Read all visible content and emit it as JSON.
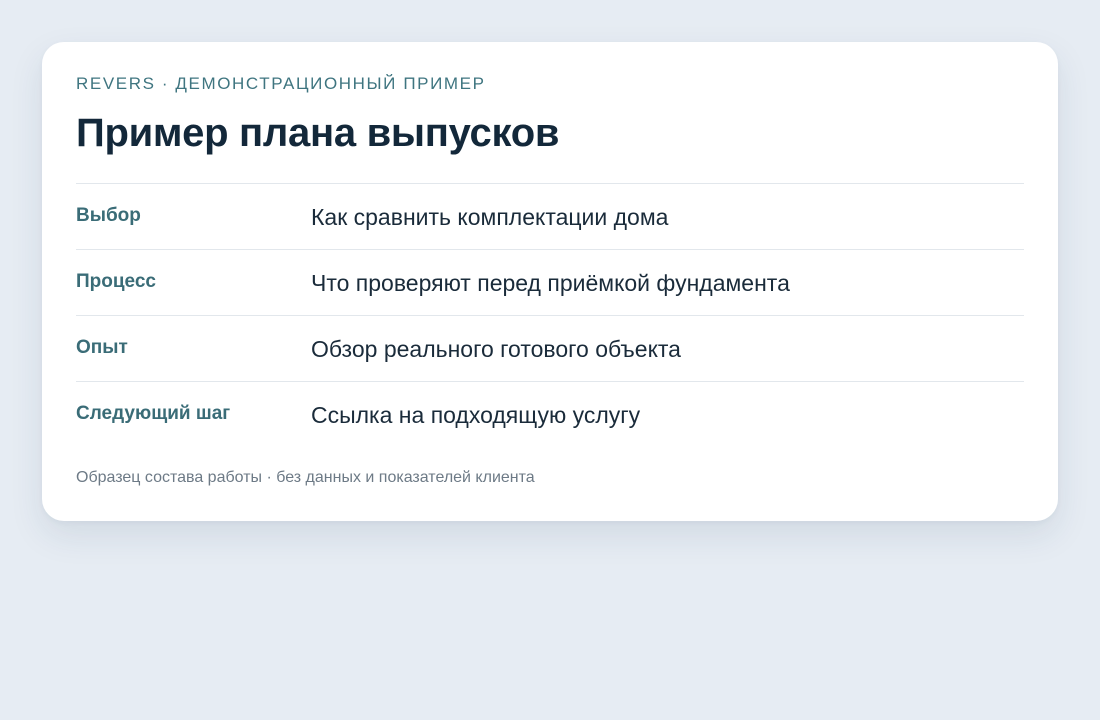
{
  "card": {
    "eyebrow": "REVERS · ДЕМОНСТРАЦИОННЫЙ ПРИМЕР",
    "title": "Пример плана выпусков",
    "rows": [
      {
        "label": "Выбор",
        "value": "Как сравнить комплектации дома"
      },
      {
        "label": "Процесс",
        "value": "Что проверяют перед приёмкой фундамента"
      },
      {
        "label": "Опыт",
        "value": "Обзор реального готового объекта"
      },
      {
        "label": "Следующий шаг",
        "value": "Ссылка на подходящую услугу"
      }
    ],
    "footnote": "Образец состава работы · без данных и показателей клиента"
  },
  "colors": {
    "background": "#e6ecf3",
    "card": "#ffffff",
    "accent": "#3f7580",
    "title": "#13283a",
    "muted": "#6d7a86"
  }
}
